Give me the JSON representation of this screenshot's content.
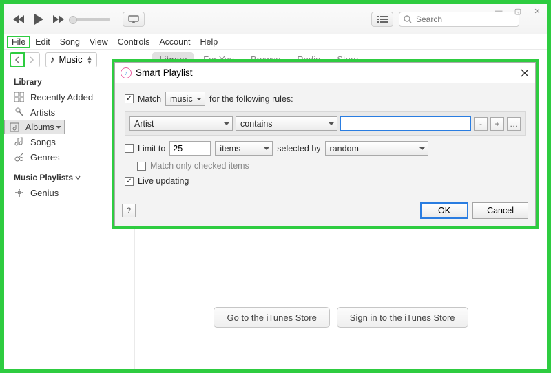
{
  "window": {
    "min": "—",
    "max": "▢",
    "close": "✕"
  },
  "search": {
    "placeholder": "Search"
  },
  "menus": {
    "file": "File",
    "edit": "Edit",
    "song": "Song",
    "view": "View",
    "controls": "Controls",
    "account": "Account",
    "help": "Help"
  },
  "mediaSelector": {
    "icon": "♪",
    "label": "Music"
  },
  "tabs": {
    "library": "Library",
    "foryou": "For You",
    "browse": "Browse",
    "radio": "Radio",
    "store": "Store"
  },
  "sidebar": {
    "header1": "Library",
    "items": [
      {
        "label": "Recently Added"
      },
      {
        "label": "Artists"
      },
      {
        "label": "Albums"
      },
      {
        "label": "Songs"
      },
      {
        "label": "Genres"
      }
    ],
    "header2": "Music Playlists",
    "genius": "Genius"
  },
  "bottom": {
    "goto": "Go to the iTunes Store",
    "signin": "Sign in to the iTunes Store"
  },
  "dialog": {
    "title": "Smart Playlist",
    "match_label": "Match",
    "match_type": "music",
    "match_suffix": "for the following rules:",
    "rule_field": "Artist",
    "rule_op": "contains",
    "rule_value": "",
    "minus": "-",
    "plus": "+",
    "ell": "…",
    "limit_label": "Limit to",
    "limit_value": "25",
    "limit_unit": "items",
    "selected_by": "selected by",
    "random": "random",
    "match_checked": "Match only checked items",
    "live": "Live updating",
    "help": "?",
    "ok": "OK",
    "cancel": "Cancel"
  },
  "chart_data": null
}
